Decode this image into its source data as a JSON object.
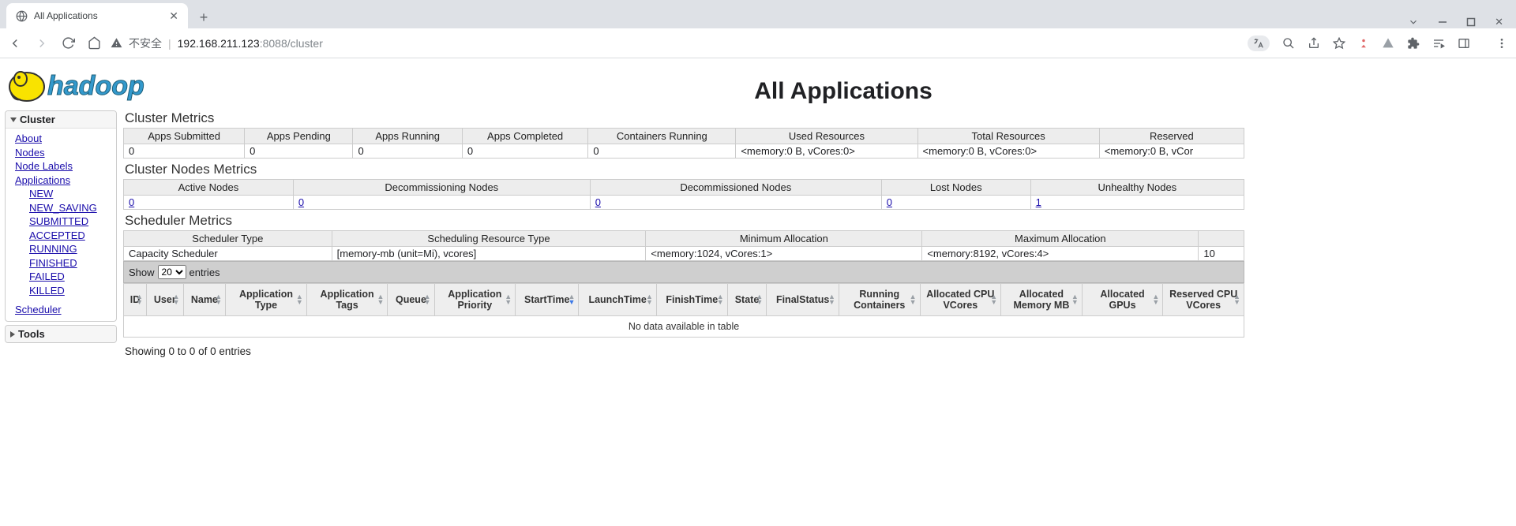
{
  "browser": {
    "tab_title": "All Applications",
    "insecure_label": "不安全",
    "url_host": "192.168.211.123",
    "url_port_path": ":8088/cluster"
  },
  "page": {
    "title": "All Applications"
  },
  "sidebar": {
    "sections": [
      {
        "label": "Cluster",
        "expanded": true
      },
      {
        "label": "Tools",
        "expanded": false
      }
    ],
    "cluster_links": {
      "about": "About",
      "nodes": "Nodes",
      "node_labels": "Node Labels",
      "applications": "Applications",
      "states": {
        "new": "NEW",
        "new_saving": "NEW_SAVING",
        "submitted": "SUBMITTED",
        "accepted": "ACCEPTED",
        "running": "RUNNING",
        "finished": "FINISHED",
        "failed": "FAILED",
        "killed": "KILLED"
      },
      "scheduler": "Scheduler"
    }
  },
  "cluster_metrics": {
    "title": "Cluster Metrics",
    "headers": [
      "Apps Submitted",
      "Apps Pending",
      "Apps Running",
      "Apps Completed",
      "Containers Running",
      "Used Resources",
      "Total Resources",
      "Reserved"
    ],
    "row": [
      "0",
      "0",
      "0",
      "0",
      "0",
      "<memory:0 B, vCores:0>",
      "<memory:0 B, vCores:0>",
      "<memory:0 B, vCor"
    ]
  },
  "nodes_metrics": {
    "title": "Cluster Nodes Metrics",
    "headers": [
      "Active Nodes",
      "Decommissioning Nodes",
      "Decommissioned Nodes",
      "Lost Nodes",
      "Unhealthy Nodes"
    ],
    "row": [
      "0",
      "0",
      "0",
      "0",
      "1"
    ]
  },
  "scheduler_metrics": {
    "title": "Scheduler Metrics",
    "headers": [
      "Scheduler Type",
      "Scheduling Resource Type",
      "Minimum Allocation",
      "Maximum Allocation",
      ""
    ],
    "row": [
      "Capacity Scheduler",
      "[memory-mb (unit=Mi), vcores]",
      "<memory:1024, vCores:1>",
      "<memory:8192, vCores:4>",
      "10"
    ]
  },
  "datatable": {
    "show_label": "Show",
    "entries_label": "entries",
    "page_size": "20",
    "columns": [
      "ID",
      "User",
      "Name",
      "Application Type",
      "Application Tags",
      "Queue",
      "Application Priority",
      "StartTime",
      "LaunchTime",
      "FinishTime",
      "State",
      "FinalStatus",
      "Running Containers",
      "Allocated CPU VCores",
      "Allocated Memory MB",
      "Allocated GPUs",
      "Reserved CPU VCores"
    ],
    "sorted_col_index": 7,
    "empty_msg": "No data available in table",
    "info": "Showing 0 to 0 of 0 entries"
  }
}
